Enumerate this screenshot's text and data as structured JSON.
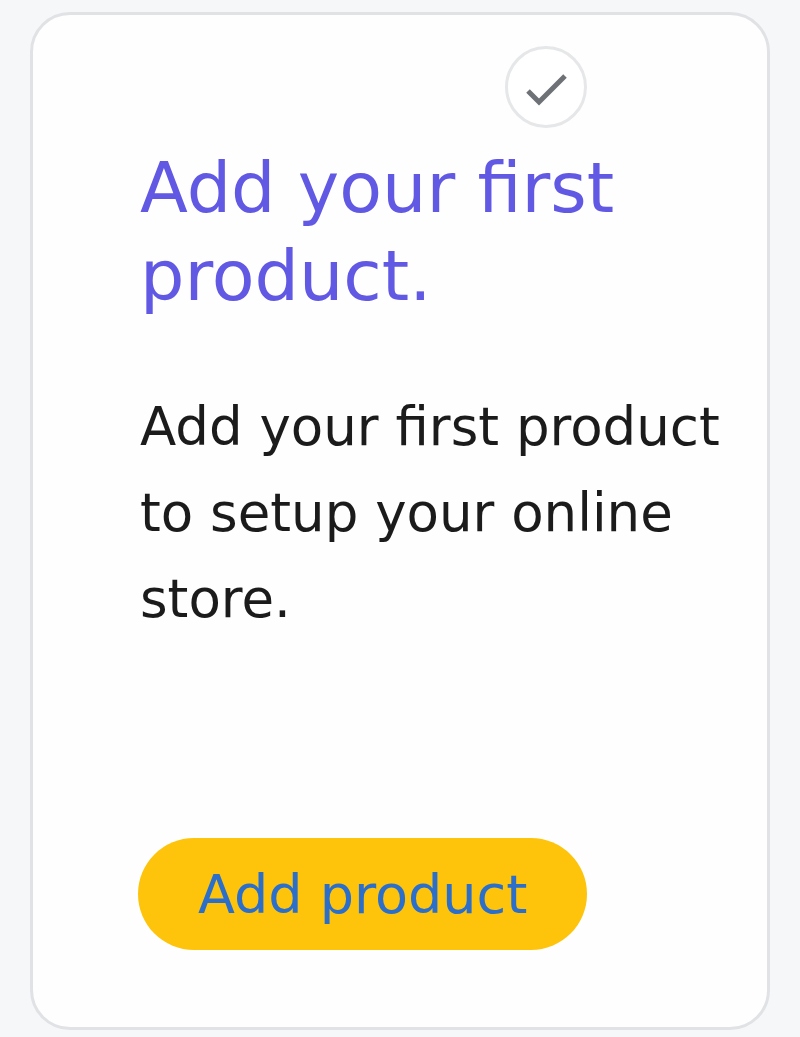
{
  "task_card": {
    "completed": false,
    "title": "Add your first product.",
    "description": "Add your first product to setup your online store.",
    "button": {
      "label": "Add product"
    }
  }
}
